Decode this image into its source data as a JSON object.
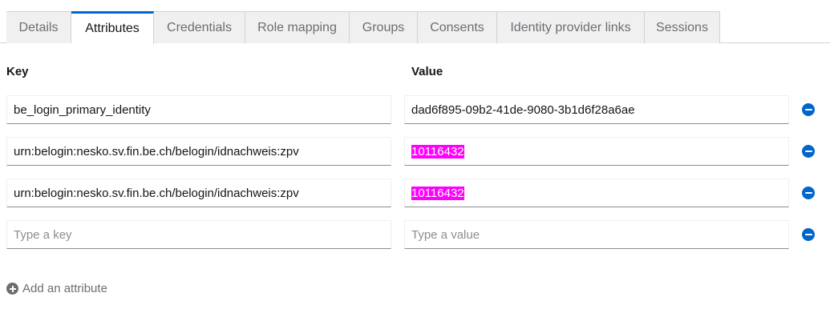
{
  "tabs": [
    {
      "label": "Details",
      "active": false
    },
    {
      "label": "Attributes",
      "active": true
    },
    {
      "label": "Credentials",
      "active": false
    },
    {
      "label": "Role mapping",
      "active": false
    },
    {
      "label": "Groups",
      "active": false
    },
    {
      "label": "Consents",
      "active": false
    },
    {
      "label": "Identity provider links",
      "active": false
    },
    {
      "label": "Sessions",
      "active": false
    }
  ],
  "attributes": {
    "key_header": "Key",
    "value_header": "Value",
    "rows": [
      {
        "key": "be_login_primary_identity",
        "value": "dad6f895-09b2-41de-9080-3b1d6f28a6ae",
        "value_highlighted": false
      },
      {
        "key": "urn:belogin:nesko.sv.fin.be.ch/belogin/idnachweis:zpv",
        "value": "10116432",
        "value_highlighted": true
      },
      {
        "key": "urn:belogin:nesko.sv.fin.be.ch/belogin/idnachweis:zpv",
        "value": "10116432",
        "value_highlighted": true
      }
    ],
    "new_row": {
      "key_placeholder": "Type a key",
      "value_placeholder": "Type a value"
    },
    "add_label": "Add an attribute"
  },
  "colors": {
    "accent": "#0066cc",
    "highlight": "#ff00ff",
    "muted": "#6a6e73"
  }
}
